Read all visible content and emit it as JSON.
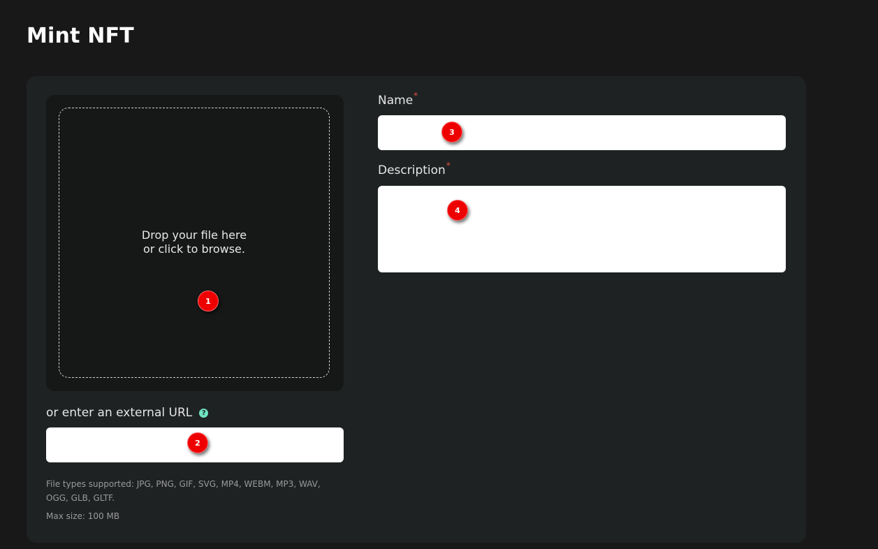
{
  "page": {
    "title": "Mint NFT"
  },
  "upload": {
    "drop_text_line1": "Drop your file here",
    "drop_text_line2": "or click to browse.",
    "url_label": "or enter an external URL",
    "help_icon": "question-mark-icon",
    "url_value": "",
    "file_types_hint": "File types supported: JPG, PNG, GIF, SVG, MP4, WEBM, MP3, WAV, OGG, GLB, GLTF.",
    "max_size_hint": "Max size: 100 MB"
  },
  "form": {
    "name_label": "Name",
    "name_value": "",
    "description_label": "Description",
    "description_value": "",
    "required_mark": "*"
  },
  "markers": [
    "1",
    "2",
    "3",
    "4"
  ],
  "colors": {
    "background": "#181818",
    "card": "#1f2223",
    "dropzone": "#161717",
    "accent_help": "#6fe4c1",
    "required": "#e0533d",
    "marker": "#ee0000"
  }
}
